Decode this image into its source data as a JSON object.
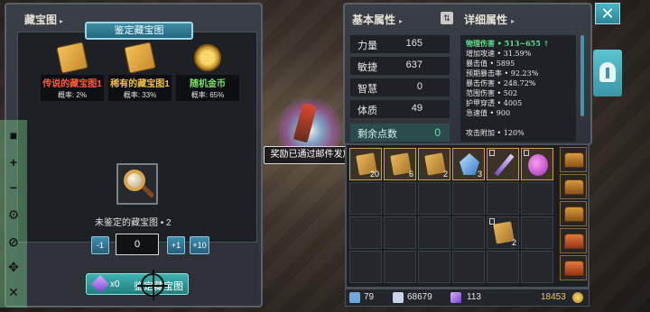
{
  "treasure_panel": {
    "title": "藏宝图",
    "tab_label": "鉴定藏宝图",
    "rewards": [
      {
        "name": "传说的藏宝图1",
        "prob": "概率: 2%",
        "color": "#ff5a3a",
        "icon": "treasure-map-icon"
      },
      {
        "name": "稀有的藏宝图1",
        "prob": "概率: 33%",
        "color": "#f2c040",
        "icon": "treasure-map-icon"
      },
      {
        "name": "随机金币",
        "prob": "概率: 65%",
        "color": "#7de06a",
        "icon": "gold-coin-icon"
      }
    ],
    "unappraised_label": "未鉴定的藏宝图 • 2",
    "qty_minus": "-1",
    "qty_value": "0",
    "qty_plus1": "+1",
    "qty_plus10": "+10",
    "gem_count": "x0",
    "appraise_button": "鉴定藏宝图"
  },
  "sidebar": {
    "icons": [
      "stop-icon",
      "zoom-in-icon",
      "zoom-out-icon",
      "settings-gear-icon",
      "eye-off-icon",
      "move-icon",
      "close-icon"
    ]
  },
  "tooltip": "奖励已通过邮件发放",
  "basic_attributes": {
    "title": "基本属性",
    "stats": [
      {
        "label": "力量",
        "value": "165"
      },
      {
        "label": "敏捷",
        "value": "637"
      },
      {
        "label": "智慧",
        "value": "0"
      },
      {
        "label": "体质",
        "value": "49"
      }
    ],
    "remaining_label": "剩余点数",
    "remaining_value": "0"
  },
  "detail_attributes": {
    "title": "详细属性",
    "lines": [
      "物理伤害 • 513~655 ↑",
      "增加攻速 • 31.59%",
      "暴击值 • 5895",
      "预期暴击率 • 92.23%",
      "暴击伤害 • 248.72%",
      "范围伤害 • 502",
      "护甲穿透 • 4005",
      "急速值 • 900",
      "",
      "攻击附加 • 120%"
    ]
  },
  "inventory": {
    "row1": [
      {
        "icon": "treasure-map-icon",
        "qty": "20"
      },
      {
        "icon": "treasure-map-icon",
        "qty": "6"
      },
      {
        "icon": "treasure-map-icon",
        "qty": "2"
      },
      {
        "icon": "ice-crystal-icon",
        "qty": "3"
      },
      {
        "icon": "purple-sword-icon",
        "qty": ""
      },
      {
        "icon": "magic-potion-icon",
        "qty": ""
      }
    ],
    "row3_item": {
      "icon": "treasure-map-icon",
      "qty": "2"
    }
  },
  "currency": {
    "arrows": "79",
    "shells": "68679",
    "gems": "113",
    "gold": "18453"
  }
}
